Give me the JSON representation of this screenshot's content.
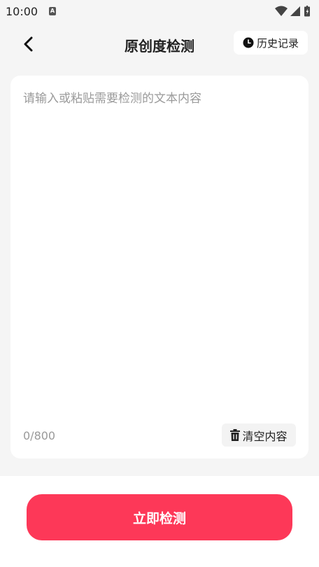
{
  "status_bar": {
    "time": "10:00",
    "notification_icon_letter": "A"
  },
  "header": {
    "title": "原创度检测",
    "history_label": "历史记录"
  },
  "editor": {
    "placeholder": "请输入或粘贴需要检测的文本内容",
    "value": "",
    "char_count": "0/800",
    "clear_label": "清空内容"
  },
  "actions": {
    "detect_label": "立即检测"
  },
  "colors": {
    "primary": "#fd3858",
    "background": "#f5f5f5",
    "card": "#ffffff",
    "placeholder_text": "#9a9a9a"
  }
}
